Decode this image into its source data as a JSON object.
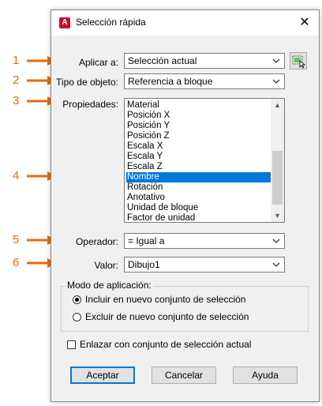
{
  "dialog": {
    "title": "Selección rápida",
    "app_icon_letter": "A",
    "close_glyph": "✕"
  },
  "fields": {
    "apply_to": {
      "label": "Aplicar a:",
      "value": "Selección actual"
    },
    "object_type": {
      "label": "Tipo de objeto:",
      "value": "Referencia a bloque"
    },
    "properties": {
      "label": "Propiedades:",
      "items": [
        "Material",
        "Posición X",
        "Posición Y",
        "Posición Z",
        "Escala X",
        "Escala Y",
        "Escala Z",
        "Nombre",
        "Rotación",
        "Anotativo",
        "Unidad de bloque",
        "Factor de unidad"
      ],
      "selected": "Nombre"
    },
    "operator": {
      "label": "Operador:",
      "value": "= Igual a"
    },
    "value": {
      "label": "Valor:",
      "value": "Dibujo1"
    }
  },
  "apply_mode": {
    "title": "Modo de aplicación:",
    "include_label": "Incluir en nuevo conjunto de selección",
    "exclude_label": "Excluir de nuevo conjunto de selección",
    "selected": "include"
  },
  "append_checkbox": {
    "label": "Enlazar con conjunto de selección actual",
    "checked": false
  },
  "buttons": {
    "ok": "Aceptar",
    "cancel": "Cancelar",
    "help": "Ayuda"
  },
  "callouts": [
    "1",
    "2",
    "3",
    "4",
    "5",
    "6"
  ],
  "colors": {
    "callout": "#e36c09",
    "selection": "#0078d7",
    "app_icon": "#c8102e"
  },
  "icons": {
    "select_objects": "select-objects-icon",
    "dropdown": "chevron-down-icon"
  }
}
